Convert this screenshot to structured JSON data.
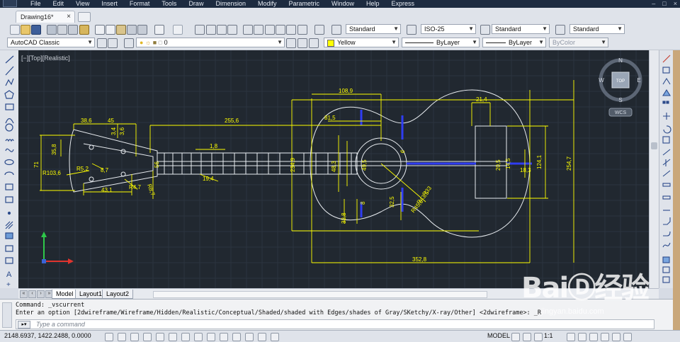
{
  "menu": {
    "items": [
      "File",
      "Edit",
      "View",
      "Insert",
      "Format",
      "Tools",
      "Draw",
      "Dimension",
      "Modify",
      "Parametric",
      "Window",
      "Help",
      "Express"
    ]
  },
  "tabs": {
    "document": "Drawing16*"
  },
  "toolbar_styles": {
    "text_style": "Standard",
    "dim_style": "ISO-25",
    "table_style": "Standard",
    "mleader_style": "Standard"
  },
  "toolbar_props": {
    "workspace": "AutoCAD Classic",
    "layer": "0",
    "color": "Yellow",
    "color_hex": "#ffff00",
    "linetype": "ByLayer",
    "lineweight": "ByLayer",
    "plotstyle": "ByColor"
  },
  "viewport": {
    "label": "[−][Top][Realistic]",
    "compass": {
      "top": "TOP",
      "n": "N",
      "s": "S",
      "e": "E",
      "w": "W",
      "ucs": "WCS"
    },
    "dimension_color": "#ffff00",
    "background": "#212830",
    "dimensions": {
      "d_38_6": "38,6",
      "d_45": "45",
      "d_3_4": "3,4",
      "d_3_6": "3,6",
      "d_255_6": "255,6",
      "d_108_9": "108,9",
      "d_81_5": "81,5",
      "d_21_4": "21,4",
      "d_35_8": "35,8",
      "d_71": "71",
      "d_r103_6": "R103,6",
      "d_r5_2": "R5,2",
      "d_43_1": "43,1",
      "d_r4_7": "R4,7",
      "d_r8_7": "R8,7",
      "d_1_8": "1,8",
      "d_19_4": "19,4",
      "d_56": "56",
      "d_234_9": "234,9",
      "d_48_3": "48,3",
      "d_49_5": "49,5",
      "d_32_8": "32,8",
      "d_8": "8",
      "d_32_5": "32,5",
      "d_r33": "R33",
      "d_r43_5": "R43,5",
      "d_r45_6": "R45,6",
      "d_20_5": "20,5",
      "d_14_5": "14,5",
      "d_18_3": "18,3",
      "d_124_1": "124,1",
      "d_254_7": "254,7",
      "d_352_8": "352,8",
      "d_6": "6",
      "d_8_7": "8,7"
    }
  },
  "layout_tabs": [
    "Model",
    "Layout1",
    "Layout2"
  ],
  "command": {
    "line1": "Command: _vscurrent",
    "line2": "Enter an option [2dwireframe/Wireframe/Hidden/Realistic/Conceptual/Shaded/shaded with Edges/shades of Gray/SKetchy/X-ray/Other] <2dwireframe>: _R",
    "placeholder": "Type a command"
  },
  "status": {
    "coords": "2148.6937, 1422.2488, 0.0000",
    "model": "MODEL",
    "scale": "1:1"
  },
  "watermark": {
    "logo": "BaiⒹ经验",
    "url": "jingyan.baidu.com"
  }
}
